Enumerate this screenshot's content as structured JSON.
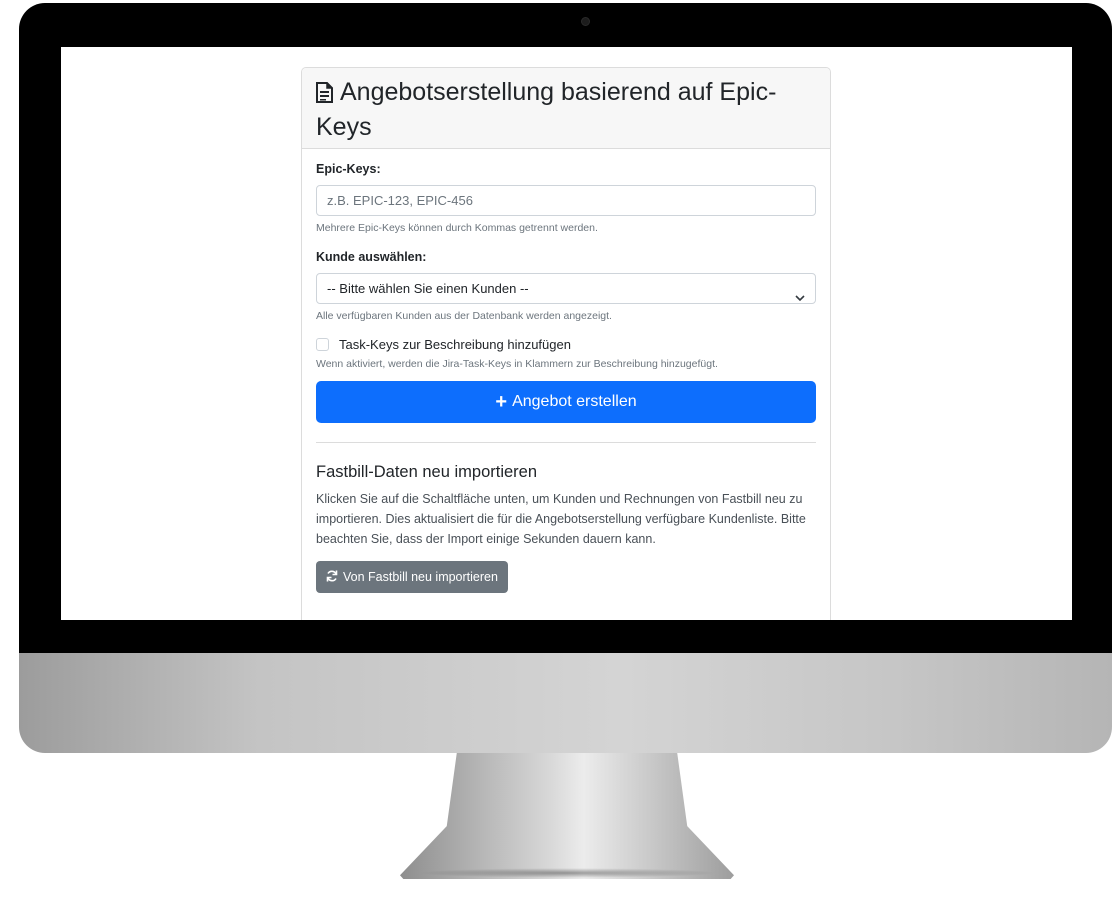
{
  "header": {
    "title": "Angebotserstellung basierend auf Epic-Keys",
    "icon": "document-icon"
  },
  "form": {
    "epic_keys_label": "Epic-Keys:",
    "epic_keys_placeholder": "z.B. EPIC-123, EPIC-456",
    "epic_keys_value": "",
    "epic_keys_help": "Mehrere Epic-Keys können durch Kommas getrennt werden.",
    "customer_label": "Kunde auswählen:",
    "customer_selected": "-- Bitte wählen Sie einen Kunden --",
    "customer_help": "Alle verfügbaren Kunden aus der Datenbank werden angezeigt.",
    "task_keys_label": "Task-Keys zur Beschreibung hinzufügen",
    "task_keys_checked": false,
    "task_keys_help": "Wenn aktiviert, werden die Jira-Task-Keys in Klammern zur Beschreibung hinzugefügt.",
    "submit_label": "Angebot erstellen",
    "submit_icon": "plus-icon"
  },
  "import_section": {
    "title": "Fastbill-Daten neu importieren",
    "description": "Klicken Sie auf die Schaltfläche unten, um Kunden und Rechnungen von Fastbill neu zu importieren. Dies aktualisiert die für die Angebotserstellung verfügbare Kundenliste. Bitte beachten Sie, dass der Import einige Sekunden dauern kann.",
    "button_label": "Von Fastbill neu importieren",
    "button_icon": "sync-icon"
  },
  "colors": {
    "primary": "#0d6efd",
    "secondary": "#6c757d",
    "header_bg": "#f7f7f7"
  }
}
